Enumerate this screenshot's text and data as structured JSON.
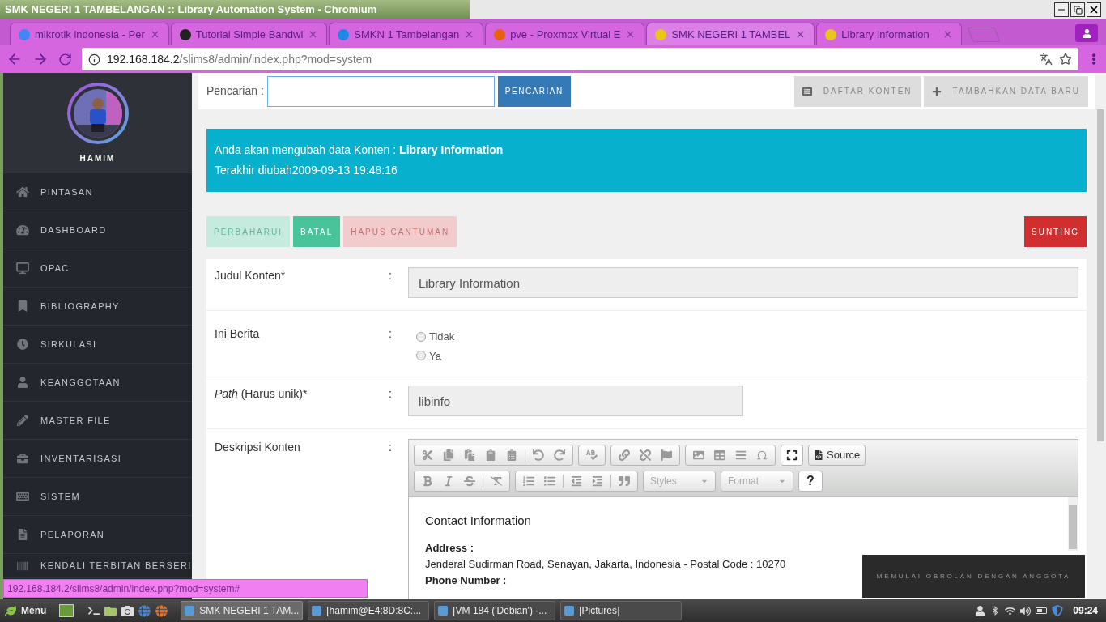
{
  "window": {
    "title": "SMK NEGERI 1 TAMBELANGAN :: Library Automation System - Chromium"
  },
  "browser": {
    "tabs": [
      {
        "title": "mikrotik indonesia - Per",
        "selected": false
      },
      {
        "title": "Tutorial Simple Bandwi",
        "selected": false
      },
      {
        "title": "SMKN 1 Tambelangan",
        "selected": false
      },
      {
        "title": "pve - Proxmox Virtual E",
        "selected": false
      },
      {
        "title": "SMK NEGERI 1 TAMBEL",
        "selected": true
      },
      {
        "title": "Library Information",
        "selected": false
      }
    ],
    "address": {
      "host": "192.168.184.2",
      "path": "/slims8/admin/index.php?mod=system"
    },
    "status_url": "192.168.184.2/slims8/admin/index.php?mod=system#"
  },
  "sidebar": {
    "user": {
      "name": "HAMIM"
    },
    "items": [
      {
        "label": "PINTASAN"
      },
      {
        "label": "DASHBOARD"
      },
      {
        "label": "OPAC"
      },
      {
        "label": "BIBLIOGRAPHY"
      },
      {
        "label": "SIRKULASI"
      },
      {
        "label": "KEANGGOTAAN"
      },
      {
        "label": "MASTER FILE"
      },
      {
        "label": "INVENTARISASI"
      },
      {
        "label": "SISTEM"
      },
      {
        "label": "PELAPORAN"
      },
      {
        "label": "KENDALI TERBITAN BERSERI"
      }
    ]
  },
  "search": {
    "label": "Pencarian :",
    "button": "PENCARIAN"
  },
  "top_buttons": [
    {
      "label": "DAFTAR KONTEN"
    },
    {
      "label": "TAMBAHKAN DATA BARU"
    }
  ],
  "info": {
    "lines": [
      "Anda akan mengubah data Konten : **Library Information**",
      "Terakhir diubah2009-09-13 19:48:16"
    ]
  },
  "actions": [
    {
      "label": "PERBAHARUI",
      "kind": "update",
      "disabled": true
    },
    {
      "label": "BATAL",
      "kind": "cancel",
      "disabled": false
    },
    {
      "label": "HAPUS CANTUMAN",
      "kind": "delete",
      "disabled": true
    },
    {
      "label": "SUNTING",
      "kind": "edit",
      "disabled": false
    }
  ],
  "form": [
    {
      "kind": "text",
      "label": "Judul Konten*",
      "colon": ":",
      "value": "Library Information"
    },
    {
      "kind": "radio",
      "label": "Ini Berita",
      "colon": ":",
      "options": [
        {
          "label": "Tidak",
          "selected": false
        },
        {
          "label": "Ya",
          "selected": false
        }
      ]
    },
    {
      "kind": "short_text",
      "label": "*Path* (Harus unik)*",
      "colon": ":",
      "value": "libinfo"
    },
    {
      "kind": "editor",
      "label": "Deskripsi Konten",
      "colon": ":",
      "source": "Source",
      "styles": "Styles",
      "format": "Format",
      "help": "?",
      "content": [
        {
          "kind": "heading",
          "text": "Contact Information"
        },
        {
          "kind": "bold",
          "text": "Address :"
        },
        {
          "kind": "para",
          "text": "Jenderal Sudirman Road, Senayan, Jakarta, Indonesia - Postal Code : 10270"
        },
        {
          "kind": "bold",
          "text": "Phone Number :"
        }
      ]
    }
  ],
  "chat": {
    "label": "MEMULAI OBROLAN DENGAN ANGGOTA"
  },
  "taskbar": {
    "menu": "Menu",
    "windows": [
      {
        "title": "SMK NEGERI 1 TAM...",
        "selected": true
      },
      {
        "title": "[hamim@E4:8D:8C:...",
        "selected": false
      },
      {
        "title": "[VM 184 ('Debian') -...",
        "selected": false
      },
      {
        "title": "[Pictures]",
        "selected": false
      }
    ],
    "clock": "09:24"
  }
}
